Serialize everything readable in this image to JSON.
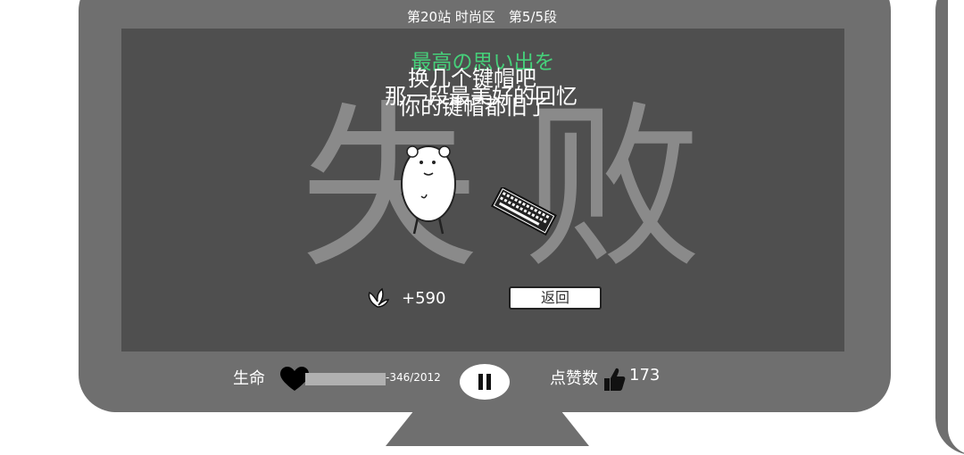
{
  "header": {
    "title": "第20站 时尚区　第5/5段"
  },
  "result": {
    "char_left": "失",
    "char_right": "败"
  },
  "messages": {
    "green": "最高の思い出を",
    "line1": "换几个键帽吧",
    "line2": "那一段最美好的回忆",
    "line3": "你的键帽都旧了"
  },
  "reward": {
    "value": "+590"
  },
  "buttons": {
    "back": "返回"
  },
  "hud": {
    "life_label": "生命",
    "hp_text": "-346/2012",
    "hp_fraction": 0,
    "likes_label": "点赞数",
    "likes_value": "173"
  },
  "colors": {
    "green_text": "#46d07a",
    "monitor": "#6f6f6f",
    "screen": "#4f4f4f"
  },
  "icons": [
    "heart-icon",
    "pause-icon",
    "thumbs-up-icon",
    "lotus-icon",
    "keyboard-icon"
  ]
}
